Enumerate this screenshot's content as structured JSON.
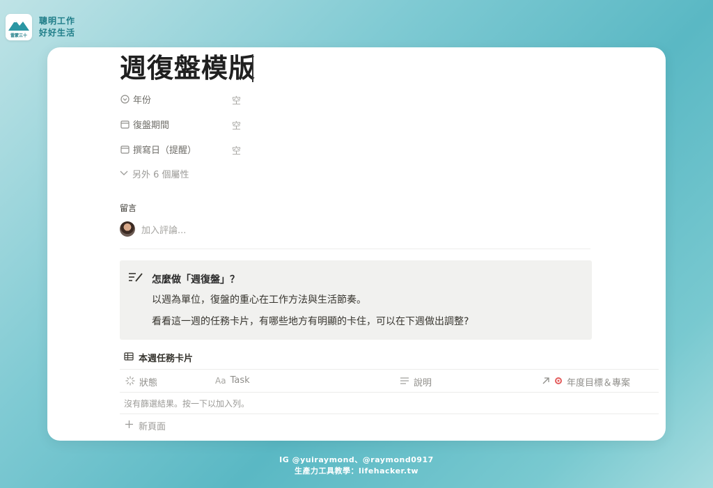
{
  "brand": {
    "logo_text": "雷蒙三十",
    "line1": "聰明工作",
    "line2": "好好生活"
  },
  "page": {
    "title": "週復盤模版"
  },
  "properties": [
    {
      "icon": "select-icon",
      "label": "年份",
      "value": "空"
    },
    {
      "icon": "calendar-icon",
      "label": "復盤期間",
      "value": "空"
    },
    {
      "icon": "calendar-icon",
      "label": "撰寫日（提醒）",
      "value": "空"
    }
  ],
  "more_properties": "另外 6 個屬性",
  "comments": {
    "label": "留言",
    "placeholder": "加入評論..."
  },
  "callout": {
    "icon": "edit-list-icon",
    "title": "怎麼做「週復盤」？",
    "lines": [
      "以週為單位，復盤的重心在工作方法與生活節奏。",
      "看看這一週的任務卡片，有哪些地方有明顯的卡住，可以在下週做出調整?"
    ]
  },
  "database": {
    "title": "本週任務卡片",
    "columns": [
      {
        "icon": "status-icon",
        "label": "狀態"
      },
      {
        "icon": "text-aa-icon",
        "label": "Task"
      },
      {
        "icon": "text-lines-icon",
        "label": "說明"
      },
      {
        "icon": "relation-arrow-icon",
        "label": "年度目標＆專案"
      }
    ],
    "empty_message": "沒有篩選結果。按一下以加入列。",
    "new_page": "新頁面"
  },
  "footer": {
    "line1": "IG @yuiraymond、@raymond0917",
    "line2": "生產力工具教學：lifehacker.tw"
  },
  "colors": {
    "brand_teal": "#1f7d88",
    "background_teal": "#5ab8c4",
    "callout_bg": "#f1f1ef"
  }
}
